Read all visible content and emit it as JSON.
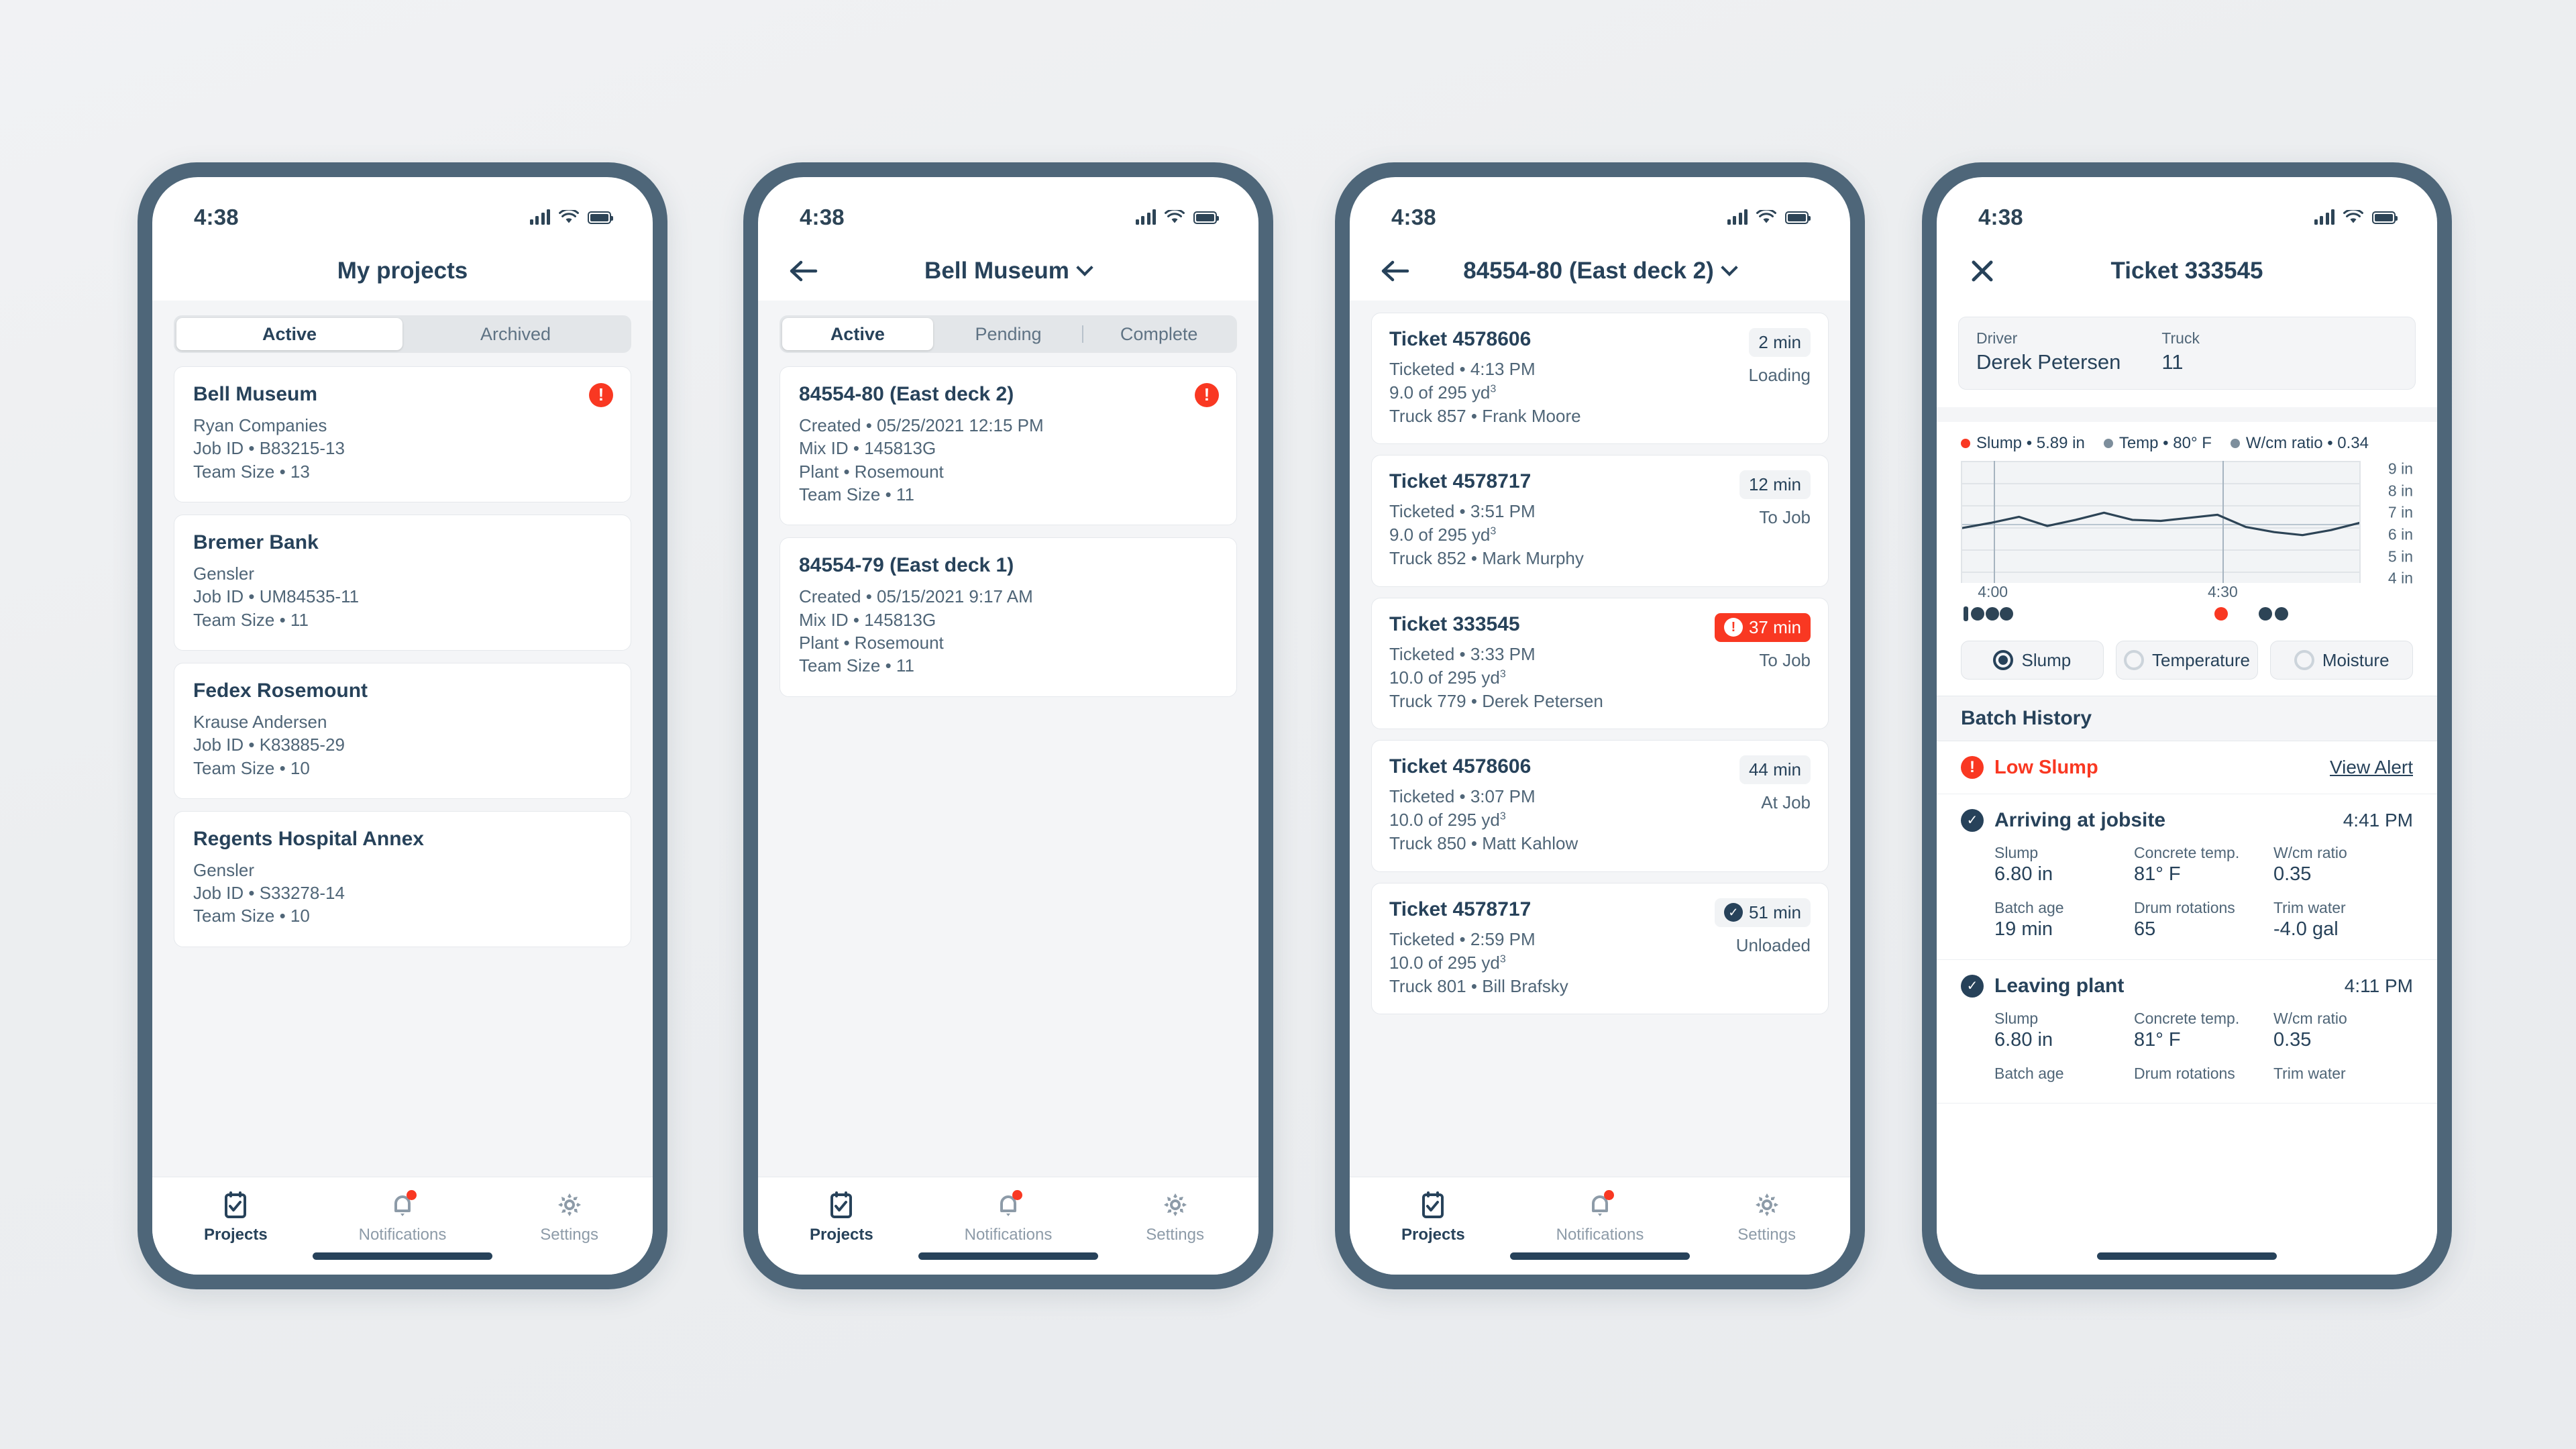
{
  "statusbar": {
    "time": "4:38"
  },
  "colors": {
    "accent_red": "#f93822",
    "navy": "#27425a",
    "bezel": "#4e6679"
  },
  "phone1": {
    "nav_title": "My projects",
    "segments": [
      {
        "label": "Active",
        "active": true
      },
      {
        "label": "Archived",
        "active": false
      }
    ],
    "projects": [
      {
        "name": "Bell Museum",
        "company": "Ryan Companies",
        "job_id": "Job ID • B83215-13",
        "team_size": "Team Size • 13",
        "alert": true
      },
      {
        "name": "Bremer Bank",
        "company": "Gensler",
        "job_id": "Job ID • UM84535-11",
        "team_size": "Team Size • 11",
        "alert": false
      },
      {
        "name": "Fedex Rosemount",
        "company": "Krause Andersen",
        "job_id": "Job ID • K83885-29",
        "team_size": "Team Size • 10",
        "alert": false
      },
      {
        "name": "Regents Hospital Annex",
        "company": "Gensler",
        "job_id": "Job ID • S33278-14",
        "team_size": "Team Size • 10",
        "alert": false
      }
    ]
  },
  "phone2": {
    "nav_title": "Bell Museum",
    "segments": [
      {
        "label": "Active",
        "active": true
      },
      {
        "label": "Pending",
        "active": false
      },
      {
        "label": "Complete",
        "active": false
      }
    ],
    "pours": [
      {
        "name": "84554-80 (East deck 2)",
        "created": "Created • 05/25/2021 12:15 PM",
        "mix": "Mix ID • 145813G",
        "plant": "Plant • Rosemount",
        "team_size": "Team Size • 11",
        "alert": true
      },
      {
        "name": "84554-79 (East deck 1)",
        "created": "Created • 05/15/2021 9:17 AM",
        "mix": "Mix ID • 145813G",
        "plant": "Plant • Rosemount",
        "team_size": "Team Size • 11",
        "alert": false
      }
    ]
  },
  "phone3": {
    "nav_title": "84554-80 (East deck 2)",
    "tickets": [
      {
        "title": "Ticket 4578606",
        "ticketed": "Ticketed • 4:13 PM",
        "qty": "9.0 of 295 yd",
        "qty_sup": "3",
        "truck": "Truck 857 • Frank Moore",
        "elapsed": "2 min",
        "status": "Loading",
        "badge_style": "plain"
      },
      {
        "title": "Ticket 4578717",
        "ticketed": "Ticketed • 3:51 PM",
        "qty": "9.0 of 295 yd",
        "qty_sup": "3",
        "truck": "Truck 852 • Mark Murphy",
        "elapsed": "12 min",
        "status": "To Job",
        "badge_style": "plain"
      },
      {
        "title": "Ticket 333545",
        "ticketed": "Ticketed • 3:33 PM",
        "qty": "10.0 of 295 yd",
        "qty_sup": "3",
        "truck": "Truck 779 • Derek Petersen",
        "elapsed": "37 min",
        "status": "To Job",
        "badge_style": "alert"
      },
      {
        "title": "Ticket 4578606",
        "ticketed": "Ticketed • 3:07 PM",
        "qty": "10.0 of 295 yd",
        "qty_sup": "3",
        "truck": "Truck 850 • Matt Kahlow",
        "elapsed": "44 min",
        "status": "At Job",
        "badge_style": "plain"
      },
      {
        "title": "Ticket 4578717",
        "ticketed": "Ticketed • 2:59 PM",
        "qty": "10.0 of 295 yd",
        "qty_sup": "3",
        "truck": "Truck 801 • Bill Brafsky",
        "elapsed": "51 min",
        "status": "Unloaded",
        "badge_style": "complete"
      }
    ]
  },
  "phone4": {
    "nav_title": "Ticket 333545",
    "driver": {
      "driver_label": "Driver",
      "driver_value": "Derek Petersen",
      "truck_label": "Truck",
      "truck_value": "11"
    },
    "legend": [
      {
        "label": "Slump • 5.89 in",
        "color": "red"
      },
      {
        "label": "Temp • 80° F",
        "color": "grey"
      },
      {
        "label": "W/cm ratio • 0.34",
        "color": "grey"
      }
    ],
    "radios": [
      {
        "label": "Slump",
        "selected": true
      },
      {
        "label": "Temperature",
        "selected": false
      },
      {
        "label": "Moisture",
        "selected": false
      }
    ],
    "batch_history_title": "Batch History",
    "alert": {
      "label": "Low Slump",
      "link": "View Alert"
    },
    "events": [
      {
        "title": "Arriving at jobsite",
        "time": "4:41 PM",
        "metrics": [
          {
            "key": "Slump",
            "value": "6.80 in"
          },
          {
            "key": "Concrete temp.",
            "value": "81° F"
          },
          {
            "key": "W/cm ratio",
            "value": "0.35"
          },
          {
            "key": "Batch age",
            "value": "19 min"
          },
          {
            "key": "Drum rotations",
            "value": "65"
          },
          {
            "key": "Trim water",
            "value": "-4.0 gal"
          }
        ]
      },
      {
        "title": "Leaving plant",
        "time": "4:11 PM",
        "metrics": [
          {
            "key": "Slump",
            "value": "6.80 in"
          },
          {
            "key": "Concrete temp.",
            "value": "81° F"
          },
          {
            "key": "W/cm ratio",
            "value": "0.35"
          },
          {
            "key": "Batch age",
            "value": ""
          },
          {
            "key": "Drum rotations",
            "value": ""
          },
          {
            "key": "Trim water",
            "value": ""
          }
        ]
      }
    ]
  },
  "tabbar": {
    "tabs": [
      {
        "label": "Projects",
        "icon": "clipboard-check-icon",
        "active": true,
        "badge": false
      },
      {
        "label": "Notifications",
        "icon": "bell-icon",
        "active": false,
        "badge": true
      },
      {
        "label": "Settings",
        "icon": "gear-icon",
        "active": false,
        "badge": false
      }
    ]
  },
  "chart_data": {
    "type": "line",
    "title": "Slump",
    "xlabel": "",
    "ylabel": "in",
    "ylim": [
      3.5,
      9.5
    ],
    "yticks": [
      4,
      5,
      6,
      7,
      8,
      9
    ],
    "ytick_labels": [
      "4 in",
      "5 in",
      "6 in",
      "7 in",
      "8 in",
      "9 in"
    ],
    "xticks": [
      "4:00",
      "4:30"
    ],
    "grid": true,
    "series": [
      {
        "name": "Slump",
        "color": "#2d4456",
        "x": [
          0,
          1,
          2,
          3,
          4,
          5,
          6,
          7,
          8,
          9,
          10,
          11,
          12,
          13
        ],
        "values": [
          6.2,
          6.45,
          6.75,
          6.3,
          6.6,
          6.95,
          6.6,
          6.55,
          6.7,
          6.85,
          6.25,
          6.0,
          5.85,
          6.1,
          6.45
        ]
      }
    ],
    "threshold_line": 6.4,
    "vertical_markers": [
      "4:00",
      "4:30"
    ],
    "point_markers": [
      {
        "x_label": "4:00",
        "color": "#2d4456",
        "shape": "bar"
      },
      {
        "x_label": "4:00",
        "color": "#2d4456",
        "shape": "dot"
      },
      {
        "x_label": "4:00",
        "color": "#2d4456",
        "shape": "dot"
      },
      {
        "x_label": "4:00",
        "color": "#2d4456",
        "shape": "dot"
      },
      {
        "x_label": "4:30",
        "color": "#f93822",
        "shape": "dot"
      },
      {
        "x_label": "4:30",
        "color": "#2d4456",
        "shape": "dot"
      },
      {
        "x_label": "4:30",
        "color": "#2d4456",
        "shape": "dot"
      }
    ]
  }
}
